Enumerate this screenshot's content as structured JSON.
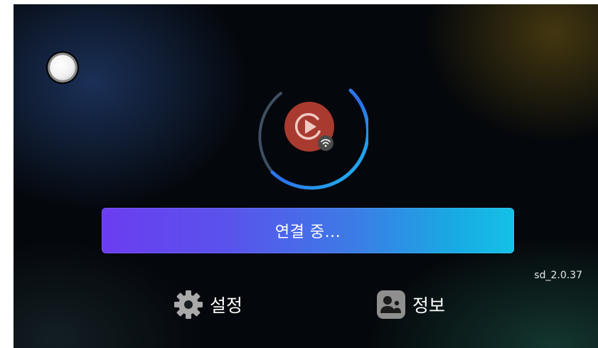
{
  "status": {
    "indicator_icon": "toggle-circle-icon",
    "app_icon": "play-cast-icon",
    "wifi_badge_icon": "wifi-icon",
    "progress_ring_icon": "loading-ring-icon"
  },
  "connect_button": {
    "label": "연결 중..."
  },
  "version": "sd_2.0.37",
  "menu": {
    "settings_label": "설정",
    "settings_icon": "gear-icon",
    "info_label": "정보",
    "info_icon": "people-icon"
  },
  "colors": {
    "background": "#04070b",
    "bar_start": "#6b3df0",
    "bar_end": "#14c1e6",
    "logo": "#a83a2f",
    "ring": "#2f7ff0"
  }
}
